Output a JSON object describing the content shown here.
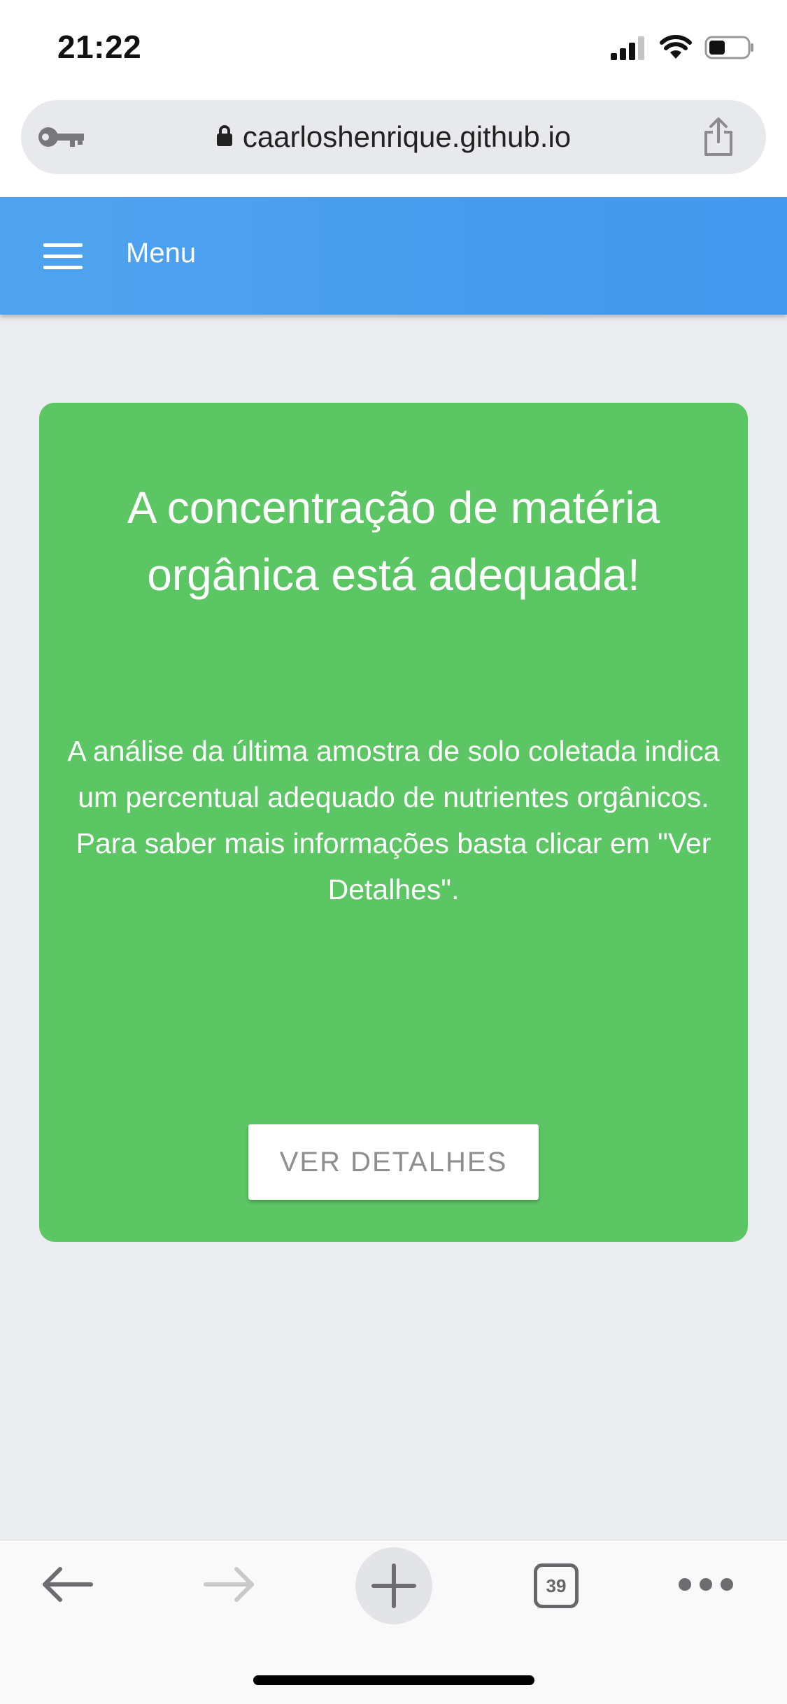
{
  "status_bar": {
    "time": "21:22"
  },
  "browser": {
    "url": "caarloshenrique.github.io"
  },
  "app_header": {
    "menu_label": "Menu",
    "color": "#4a9ff0"
  },
  "card": {
    "title": "A concentração de matéria orgânica está adequada!",
    "body": "A análise da última amostra de solo coletada indica um percentual adequado de nutrientes orgânicos. Para saber mais informações basta clicar em \"Ver Detalhes\".",
    "button_label": "VER DETALHES",
    "color": "#5cc564"
  },
  "toolbar": {
    "tab_count": "39",
    "icons": [
      "back-arrow-icon",
      "forward-arrow-icon",
      "new-tab-plus-icon",
      "tabs-icon",
      "more-dots-icon"
    ]
  },
  "icons": {
    "status": [
      "cellular-signal-icon",
      "wifi-icon",
      "battery-icon"
    ],
    "url_bar": [
      "key-icon",
      "lock-icon",
      "share-icon"
    ],
    "header": [
      "hamburger-menu-icon"
    ]
  }
}
